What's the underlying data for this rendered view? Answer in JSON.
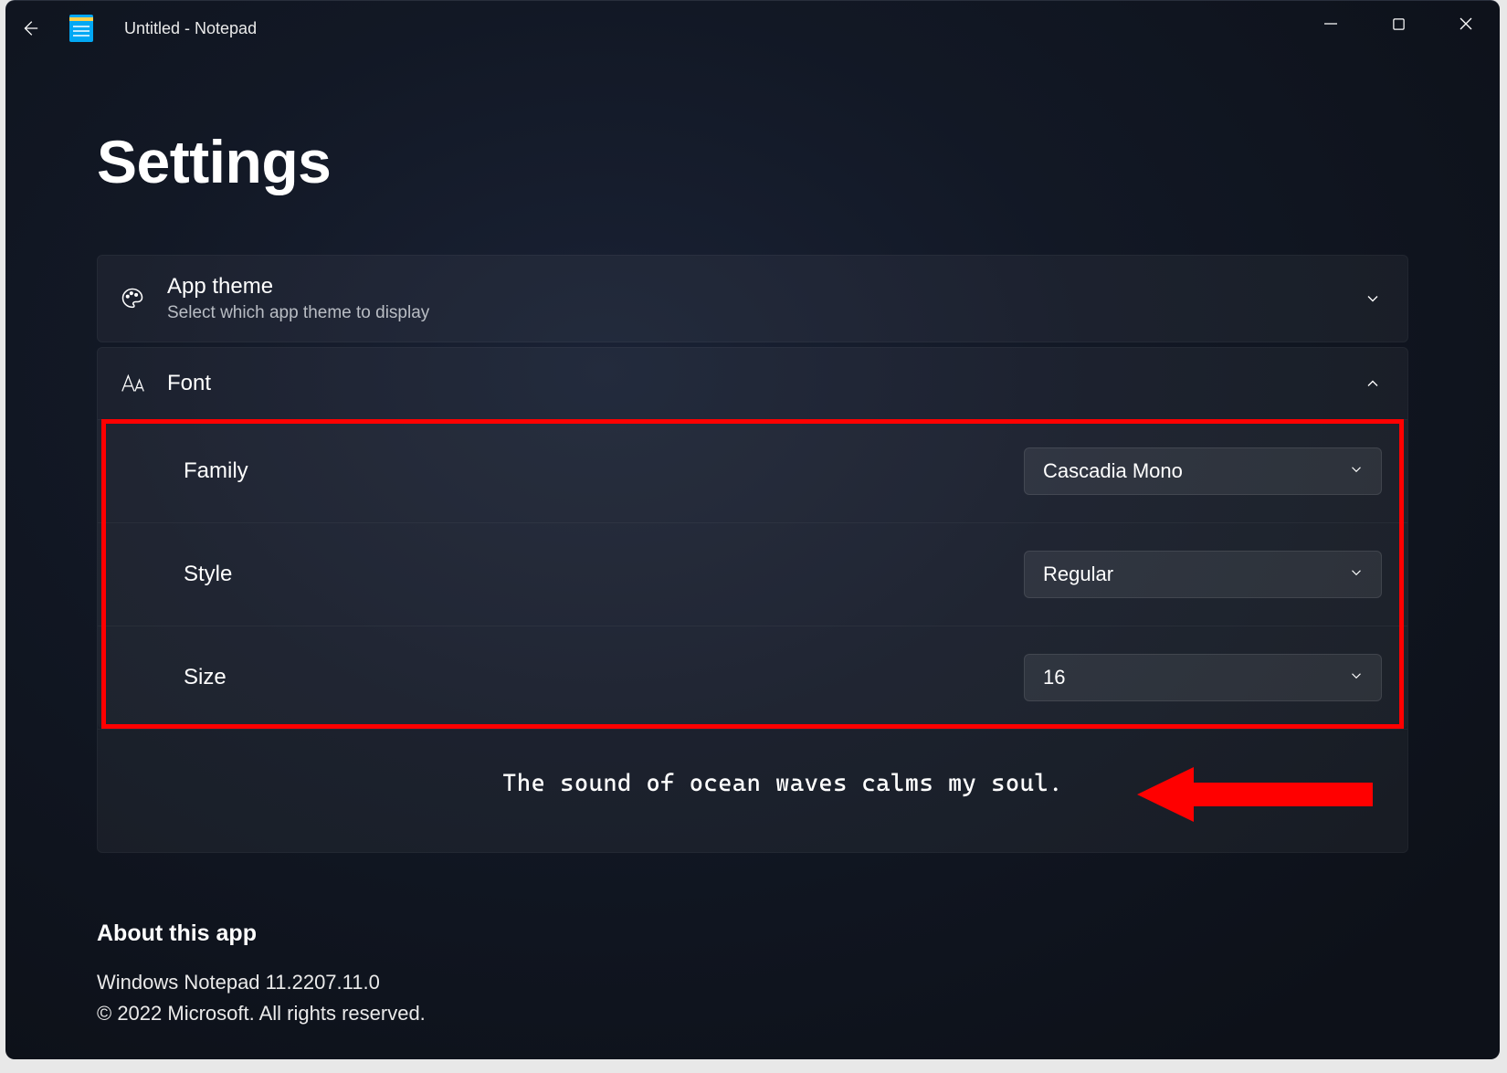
{
  "window": {
    "title": "Untitled - Notepad"
  },
  "page": {
    "heading": "Settings"
  },
  "theme": {
    "title": "App theme",
    "subtitle": "Select which app theme to display"
  },
  "font": {
    "title": "Font",
    "family": {
      "label": "Family",
      "value": "Cascadia Mono"
    },
    "style": {
      "label": "Style",
      "value": "Regular"
    },
    "size": {
      "label": "Size",
      "value": "16"
    },
    "preview": "The sound of ocean waves calms my soul."
  },
  "about": {
    "title": "About this app",
    "line1": "Windows Notepad 11.2207.11.0",
    "line2": "© 2022 Microsoft. All rights reserved."
  },
  "annotation": {
    "highlight_color": "#ff0000"
  }
}
